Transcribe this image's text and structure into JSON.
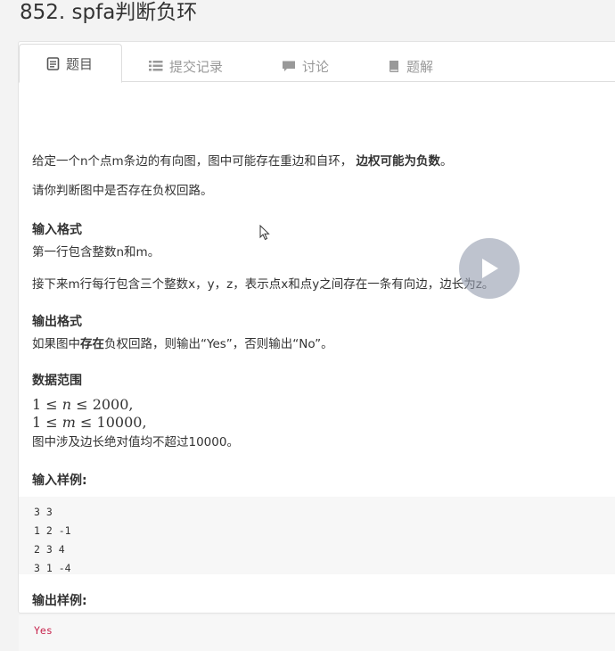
{
  "problem": {
    "title": "852. spfa判断负环"
  },
  "tabs": [
    {
      "label": "题目",
      "icon": "document-icon",
      "active": true
    },
    {
      "label": "提交记录",
      "icon": "list-icon",
      "active": false
    },
    {
      "label": "讨论",
      "icon": "comment-icon",
      "active": false
    },
    {
      "label": "题解",
      "icon": "book-icon",
      "active": false
    }
  ],
  "description": {
    "line1_prefix": "给定一个n个点m条边的有向图，图中可能存在重边和自环，",
    "line1_bold": "边权可能为负数",
    "line1_suffix": "。",
    "line2": "请你判断图中是否存在负权回路。"
  },
  "input_format": {
    "heading": "输入格式",
    "line1": "第一行包含整数n和m。",
    "line2": "接下来m行每行包含三个整数x，y，z，表示点x和点y之间存在一条有向边，边长为z。"
  },
  "output_format": {
    "heading": "输出格式",
    "prefix": "如果图中",
    "bold": "存在",
    "suffix": "负权回路，则输出“Yes”，否则输出“No”。"
  },
  "range": {
    "heading": "数据范围",
    "math1": {
      "lhs": "1",
      "op1": "≤",
      "var": "n",
      "op2": "≤",
      "rhs": "2000",
      "end": ","
    },
    "math2": {
      "lhs": "1",
      "op1": "≤",
      "var": "m",
      "op2": "≤",
      "rhs": "10000",
      "end": ","
    },
    "note": "图中涉及边长绝对值均不超过10000。"
  },
  "sample_input": {
    "heading": "输入样例:",
    "lines": [
      "3 3",
      "1 2 -1",
      "2 3 4",
      "3 1 -4"
    ]
  },
  "sample_output": {
    "heading": "输出样例:",
    "value": "Yes"
  },
  "colors": {
    "output_text": "#c7254e",
    "play_overlay": "#969eb0"
  }
}
